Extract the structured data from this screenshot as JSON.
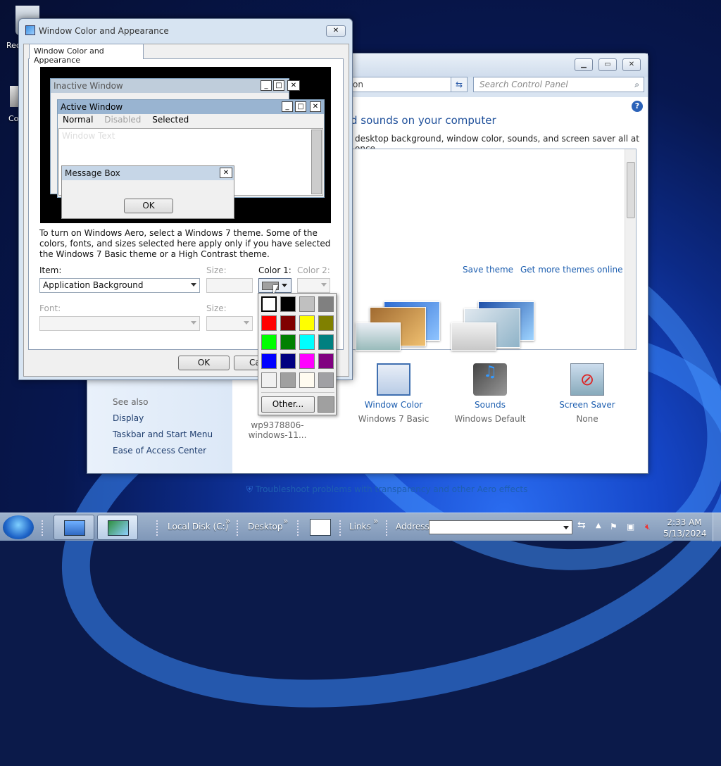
{
  "desktop": {
    "icons": [
      {
        "label": "Rec"
      },
      {
        "label": "Co"
      }
    ]
  },
  "control_panel": {
    "address_text": "on",
    "search_placeholder": "Search Control Panel",
    "title": "d sounds on your computer",
    "subtitle": "desktop background, window color, sounds, and screen saver all at once.",
    "save_theme": "Save theme",
    "get_more_themes": "Get more themes online",
    "see_also": {
      "heading": "See also",
      "links": [
        "Display",
        "Taskbar and Start Menu",
        "Ease of Access Center"
      ]
    },
    "items": [
      {
        "label": "wp9378806-windows-11...",
        "value": ""
      },
      {
        "label": "Window Color",
        "value": "Windows 7 Basic"
      },
      {
        "label": "Sounds",
        "value": "Windows Default"
      },
      {
        "label": "Screen Saver",
        "value": "None"
      }
    ],
    "troubleshoot": "Troubleshoot problems with transparency and other Aero effects"
  },
  "dialog": {
    "title": "Window Color and Appearance",
    "tab": "Window Color and Appearance",
    "preview": {
      "inactive_title": "Inactive Window",
      "active_title": "Active Window",
      "menu": {
        "normal": "Normal",
        "disabled": "Disabled",
        "selected": "Selected"
      },
      "window_text": "Window Text",
      "message_title": "Message Box",
      "ok": "OK"
    },
    "info": "To turn on Windows Aero, select a Windows 7 theme.  Some of the colors, fonts, and sizes selected here apply only if you have selected the Windows 7 Basic theme or a High Contrast theme.",
    "item_label": "Item:",
    "item_value": "Application Background",
    "size_label": "Size:",
    "color1_label": "Color 1:",
    "color2_label": "Color 2:",
    "font_label": "Font:",
    "font_size_label": "Size:",
    "ok_button": "OK",
    "cancel_button": "Ca",
    "color1_value": "#a0a0a0"
  },
  "color_popup": {
    "swatches": [
      "#ffffff",
      "#000000",
      "#c0c0c0",
      "#808080",
      "#ff0000",
      "#800000",
      "#ffff00",
      "#808000",
      "#00ff00",
      "#008000",
      "#00ffff",
      "#008080",
      "#0000ff",
      "#000080",
      "#ff00ff",
      "#800080",
      "#f0f0f0",
      "#a0a0a0",
      "#fffbf0",
      "#a0a0a4"
    ],
    "other_label": "Other...",
    "selected_index": 0
  },
  "taskbar": {
    "toolbars": [
      "Local Disk (C:)",
      "Desktop",
      "Links",
      "Address"
    ],
    "chevron": "»",
    "time": "2:33 AM",
    "date": "5/13/2024"
  }
}
